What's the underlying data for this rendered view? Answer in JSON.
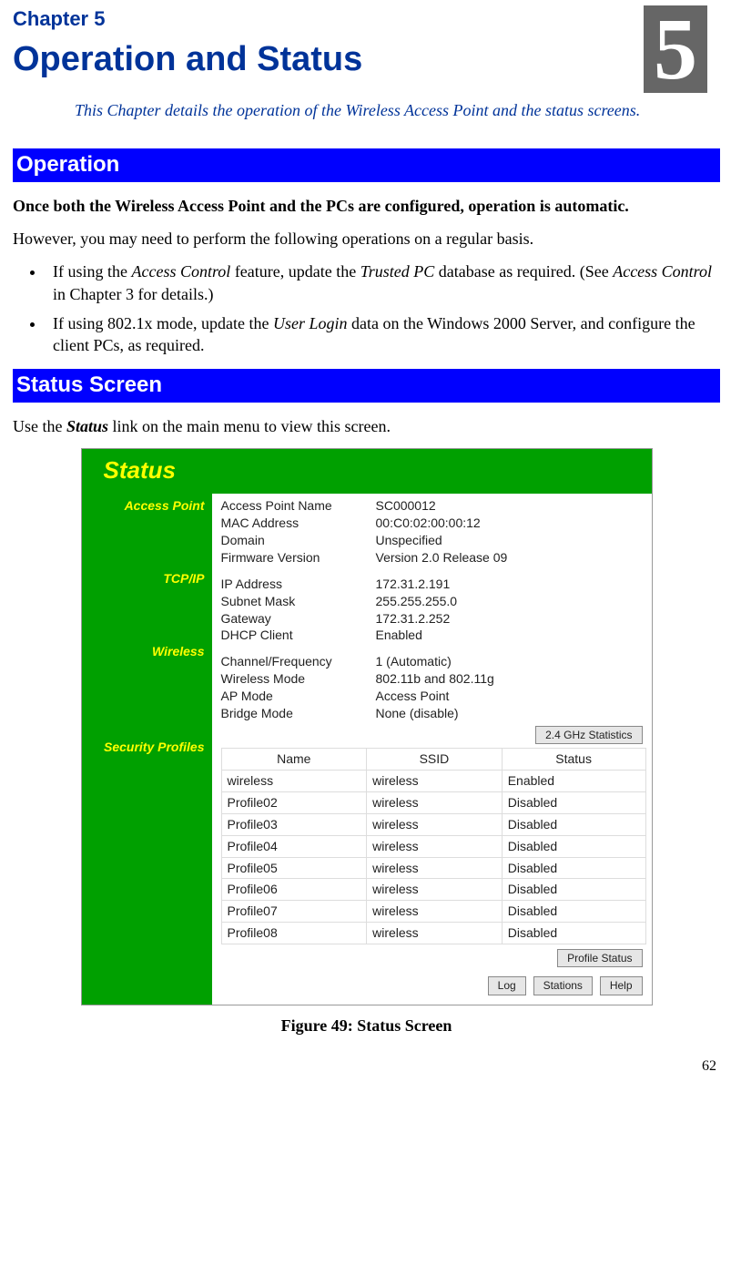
{
  "chapter_label": "Chapter 5",
  "chapter_title": "Operation and Status",
  "big_num": "5",
  "intro_prefix": "This Chapter details the operation of the Wireless Access Point and the status screens.",
  "operation_header": "Operation",
  "status_header": "Status Screen",
  "op_line1": "Once both the Wireless Access Point and the PCs are configured, operation is automatic.",
  "op_line2": "However, you may need to perform the following operations on a regular basis.",
  "bullets": {
    "b1_pre": "If using the ",
    "b1_i1": "Access Control",
    "b1_mid": " feature, update the ",
    "b1_i2": "Trusted PC",
    "b1_post": " database as required. (See ",
    "b1_i3": "Access Control",
    "b1_tail": " in Chapter 3 for details.)",
    "b2_pre": "If using 802.1x mode, update the ",
    "b2_i1": "User Login",
    "b2_post": " data on the Windows 2000 Server, and configure the client PCs, as required."
  },
  "status_sentence_pre": "Use the ",
  "status_sentence_em": "Status",
  "status_sentence_post": " link on the main menu to view this screen.",
  "status": {
    "title": "Status",
    "sections": {
      "ap": {
        "label": "Access Point",
        "rows": [
          {
            "k": "Access Point Name",
            "v": "SC000012"
          },
          {
            "k": "MAC Address",
            "v": "00:C0:02:00:00:12"
          },
          {
            "k": "Domain",
            "v": "Unspecified"
          },
          {
            "k": "Firmware Version",
            "v": "Version 2.0 Release 09"
          }
        ]
      },
      "tcp": {
        "label": "TCP/IP",
        "rows": [
          {
            "k": "IP Address",
            "v": "172.31.2.191"
          },
          {
            "k": "Subnet Mask",
            "v": "255.255.255.0"
          },
          {
            "k": "Gateway",
            "v": "172.31.2.252"
          },
          {
            "k": "DHCP Client",
            "v": "Enabled"
          }
        ]
      },
      "wl": {
        "label": "Wireless",
        "rows": [
          {
            "k": "Channel/Frequency",
            "v": "1 (Automatic)"
          },
          {
            "k": "Wireless Mode",
            "v": "802.11b and 802.11g"
          },
          {
            "k": "AP Mode",
            "v": "Access Point"
          },
          {
            "k": "Bridge Mode",
            "v": "None (disable)"
          }
        ]
      },
      "sec": {
        "label": "Security Profiles",
        "headers": {
          "name": "Name",
          "ssid": "SSID",
          "status": "Status"
        },
        "profiles": [
          {
            "name": "wireless",
            "ssid": "wireless",
            "status": "Enabled"
          },
          {
            "name": "Profile02",
            "ssid": "wireless",
            "status": "Disabled"
          },
          {
            "name": "Profile03",
            "ssid": "wireless",
            "status": "Disabled"
          },
          {
            "name": "Profile04",
            "ssid": "wireless",
            "status": "Disabled"
          },
          {
            "name": "Profile05",
            "ssid": "wireless",
            "status": "Disabled"
          },
          {
            "name": "Profile06",
            "ssid": "wireless",
            "status": "Disabled"
          },
          {
            "name": "Profile07",
            "ssid": "wireless",
            "status": "Disabled"
          },
          {
            "name": "Profile08",
            "ssid": "wireless",
            "status": "Disabled"
          }
        ]
      }
    },
    "btn_stats": "2.4 GHz Statistics",
    "btn_profile": "Profile Status",
    "btn_log": "Log",
    "btn_stations": "Stations",
    "btn_help": "Help"
  },
  "figure_caption": "Figure 49: Status Screen",
  "page_number": "62"
}
